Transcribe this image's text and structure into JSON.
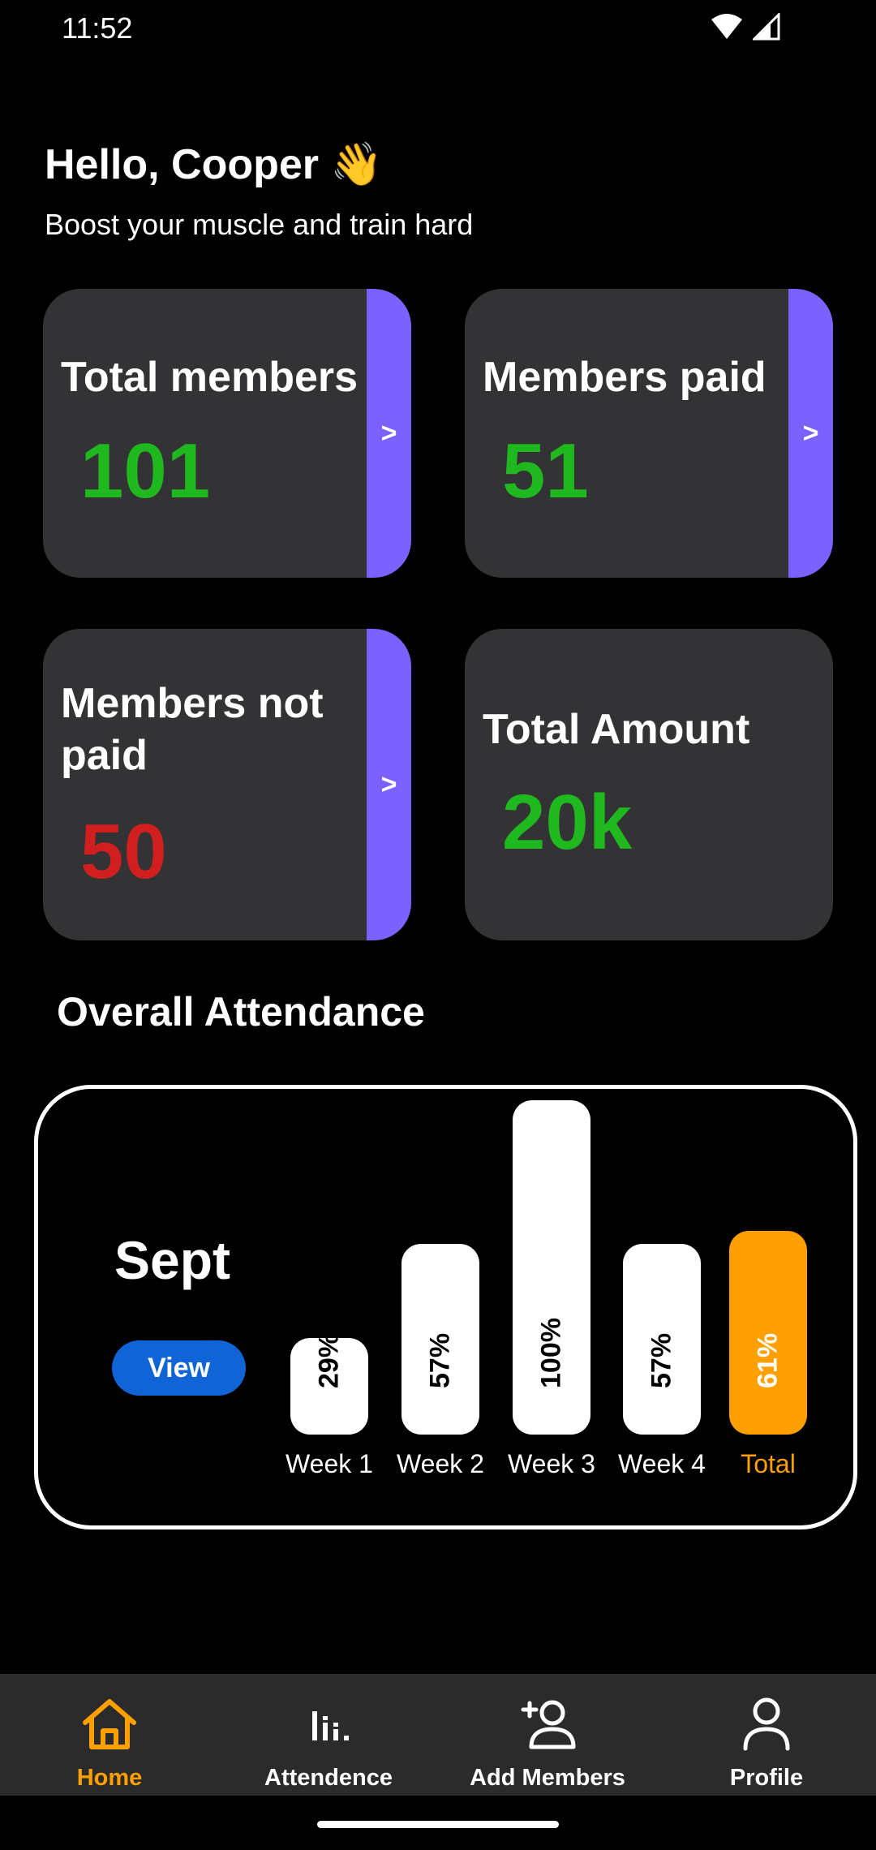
{
  "status_bar": {
    "time": "11:52"
  },
  "header": {
    "greeting": "Hello, Cooper",
    "wave_emoji": "👋",
    "subtitle": "Boost your muscle and train hard"
  },
  "cards": [
    {
      "title": "Total members",
      "value": "101",
      "value_color": "#1fb81f",
      "arrow": ">"
    },
    {
      "title": "Members paid",
      "value": "51",
      "value_color": "#1fb81f",
      "arrow": ">"
    },
    {
      "title": "Members not paid",
      "value": "50",
      "value_color": "#d11f1f",
      "arrow": ">"
    },
    {
      "title": "Total Amount",
      "value": "20k",
      "value_color": "#1fb81f"
    }
  ],
  "attendance": {
    "title": "Overall Attendance",
    "month": "Sept",
    "view_label": "View",
    "bars": [
      {
        "label": "Week 1",
        "value": 29,
        "text": "29%"
      },
      {
        "label": "Week 2",
        "value": 57,
        "text": "57%"
      },
      {
        "label": "Week 3",
        "value": 100,
        "text": "100%"
      },
      {
        "label": "Week 4",
        "value": 57,
        "text": "57%"
      },
      {
        "label": "Total",
        "value": 61,
        "text": "61%",
        "highlight": true
      }
    ]
  },
  "bottom_nav": {
    "items": [
      {
        "label": "Home",
        "icon": "home-icon",
        "active": true
      },
      {
        "label": "Attendence",
        "icon": "bar-chart-icon",
        "active": false
      },
      {
        "label": "Add Members",
        "icon": "add-user-icon",
        "active": false
      },
      {
        "label": "Profile",
        "icon": "profile-icon",
        "active": false
      }
    ]
  },
  "colors": {
    "accent": "#ffa000",
    "arrow_panel": "#7b61ff",
    "card_bg": "#333234",
    "view_button": "#1064d6"
  }
}
